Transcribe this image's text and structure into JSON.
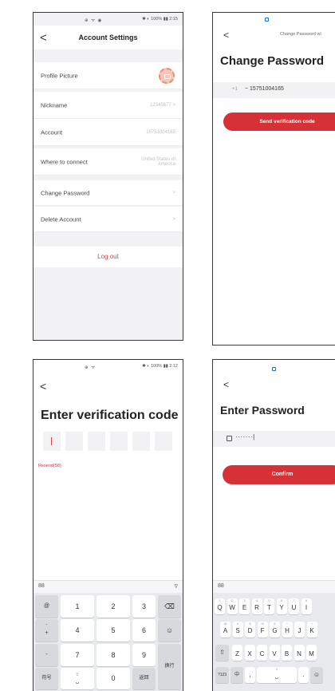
{
  "screen1": {
    "status_left": "⊕ ᯤ ◉",
    "status_right": "✱ ◐ 100% ▮▮ 2:15",
    "title": "Account Settings",
    "back": "<",
    "rows": [
      {
        "label": "Profile Picture",
        "value": ""
      },
      {
        "label": "Nickname",
        "value": "12345677  >"
      },
      {
        "label": "Account",
        "value": "15751004165"
      },
      {
        "label": "Where to connect",
        "value": "United States of America"
      },
      {
        "label": "Change Password",
        "value": ">"
      },
      {
        "label": "Delete Account",
        "value": ">"
      }
    ],
    "logout": "Log out"
  },
  "screen2": {
    "back": "<",
    "top_title": "Change Password wi",
    "title": "Change Password",
    "country_code": "+1",
    "phone": "~ 15751004165",
    "button": "Send verification code"
  },
  "screen3": {
    "status_left": "⊕ ᯤ",
    "status_right": "✱ ◐ 100% ▮▮ 2:12",
    "back": "<",
    "title": "Enter verification code",
    "resend": "Resend(58)",
    "keyboard_grid": "88",
    "keyboard_hide": "▿",
    "keys": {
      "k1": "1",
      "k2": "2",
      "k3": "3",
      "k4": "4",
      "k5": "5",
      "k6": "6",
      "k7": "7",
      "k8": "8",
      "k9": "9",
      "k0": "0",
      "at": "@",
      "dot": ".",
      "plus": "+",
      "minus": "-",
      "symbols": "符号",
      "space_sub": "0",
      "return": "返回",
      "enter": "换行",
      "backspace": "⌫",
      "emoji": "☺"
    }
  },
  "screen4": {
    "back": "<",
    "title": "Enter Password",
    "password_mask": "·······|",
    "button": "Confirm",
    "keyboard_grid": "88",
    "row1": [
      {
        "k": "Q",
        "s": "1"
      },
      {
        "k": "W",
        "s": "2"
      },
      {
        "k": "E",
        "s": "3"
      },
      {
        "k": "R",
        "s": "4"
      },
      {
        "k": "T",
        "s": "5"
      },
      {
        "k": "Y",
        "s": "6"
      },
      {
        "k": "U",
        "s": "7"
      },
      {
        "k": "I",
        "s": "8"
      }
    ],
    "row2": [
      {
        "k": "A",
        "s": "@"
      },
      {
        "k": "S",
        "s": "#"
      },
      {
        "k": "D",
        "s": "$"
      },
      {
        "k": "F",
        "s": "%"
      },
      {
        "k": "G",
        "s": "&"
      },
      {
        "k": "H",
        "s": "*"
      },
      {
        "k": "J",
        "s": "-"
      },
      {
        "k": "K",
        "s": "+"
      }
    ],
    "row3": [
      "Z",
      "X",
      "C",
      "V",
      "B",
      "N",
      "M"
    ],
    "shift": "⇧",
    "num_switch": "?123",
    "lang": "中",
    "comma": ",",
    "space_sub": "0",
    "period": ".",
    "emoji": "☺"
  }
}
